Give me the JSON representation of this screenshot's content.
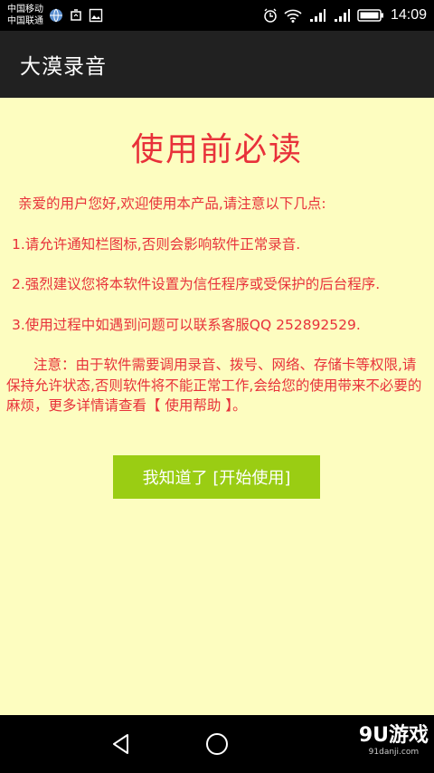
{
  "status_bar": {
    "carrier_1": "中国移动",
    "carrier_2": "中国联通",
    "time": "14:09",
    "icons": [
      "globe-icon",
      "recycle-icon",
      "image-icon",
      "alarm-icon",
      "wifi-icon",
      "signal-icon",
      "signal-icon",
      "battery-icon"
    ]
  },
  "app_bar": {
    "title": "大漠录音"
  },
  "notice": {
    "heading": "使用前必读",
    "paragraphs": [
      "亲爱的用户您好,欢迎使用本产品,请注意以下几点:",
      "1.请允许通知栏图标,否则会影响软件正常录音.",
      "2.强烈建议您将本软件设置为信任程序或受保护的后台程序.",
      "3.使用过程中如遇到问题可以联系客服QQ 252892529.",
      "注意：由于软件需要调用录音、拨号、网络、存储卡等权限,请保持允许状态,否则软件将不能正常工作,会给您的使用带来不必要的麻烦，更多详情请查看【 使用帮助 】。"
    ],
    "button_label": "我知道了 [开始使用]"
  },
  "nav_bar": {
    "watermark": "9U游戏",
    "watermark_sub": "91danji.com"
  },
  "colors": {
    "background": "#fdfdc0",
    "text_red": "#e8313a",
    "button_green": "#9acd13",
    "app_bar": "#212121"
  }
}
